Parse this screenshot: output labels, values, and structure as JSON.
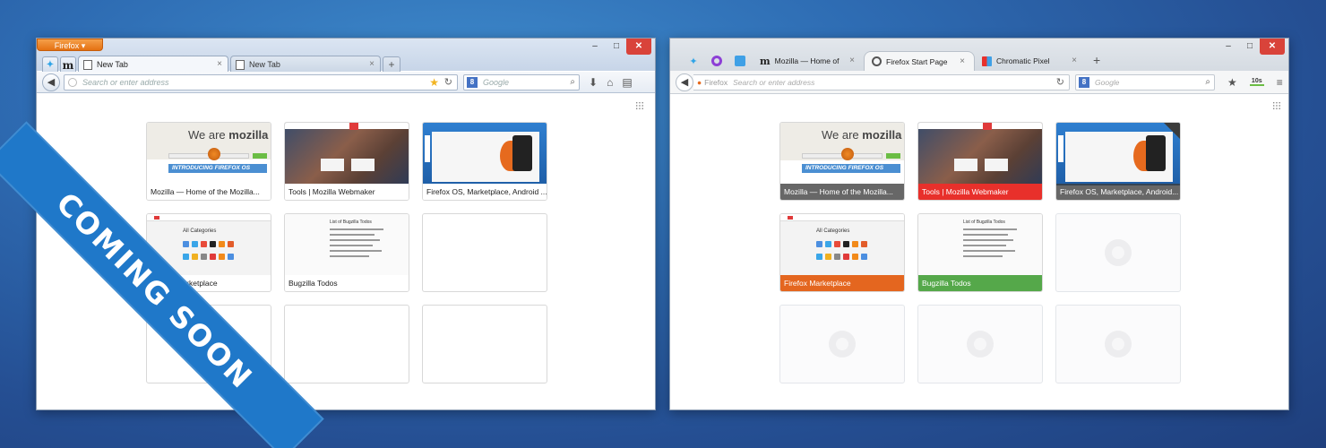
{
  "left_window": {
    "firefox_menu": "Firefox ▾",
    "tabs": [
      {
        "label": "New Tab",
        "close": "×"
      },
      {
        "label": "New Tab",
        "close": "×"
      }
    ],
    "new_tab_plus": "+",
    "url_placeholder": "Search or enter address",
    "search_engine": "Google",
    "tiles": [
      {
        "caption": "Mozilla — Home of the Mozilla...",
        "thumb": "mozilla"
      },
      {
        "caption": "Tools | Mozilla Webmaker",
        "thumb": "webmaker"
      },
      {
        "caption": "Firefox OS, Marketplace, Android ...",
        "thumb": "firefox-os"
      },
      {
        "caption": "Firefox Marketplace",
        "thumb": "marketplace"
      },
      {
        "caption": "Bugzilla Todos",
        "thumb": "bugzilla"
      },
      {
        "caption": "",
        "thumb": "empty"
      },
      {
        "caption": "",
        "thumb": "empty"
      },
      {
        "caption": "",
        "thumb": "empty"
      },
      {
        "caption": "",
        "thumb": "empty"
      }
    ]
  },
  "right_window": {
    "tabs": [
      {
        "label": "Mozilla — Home of",
        "close": "×"
      },
      {
        "label": "Firefox Start Page",
        "close": "×"
      },
      {
        "label": "Chromatic Pixel",
        "close": "×"
      }
    ],
    "new_tab_plus": "+",
    "url_identity": "Firefox",
    "url_placeholder": "Search or enter address",
    "search_engine": "Google",
    "download_label": "10s",
    "tiles": [
      {
        "caption": "Mozilla — Home of the Mozilla...",
        "thumb": "mozilla",
        "style": "dark"
      },
      {
        "caption": "Tools | Mozilla Webmaker",
        "thumb": "webmaker",
        "style": "red"
      },
      {
        "caption": "Firefox OS, Marketplace, Android...",
        "thumb": "firefox-os",
        "style": "dark"
      },
      {
        "caption": "Firefox Marketplace",
        "thumb": "marketplace",
        "style": "orange"
      },
      {
        "caption": "Bugzilla Todos",
        "thumb": "bugzilla",
        "style": "green"
      },
      {
        "caption": "",
        "thumb": "empty"
      },
      {
        "caption": "",
        "thumb": "empty"
      },
      {
        "caption": "",
        "thumb": "empty"
      },
      {
        "caption": "",
        "thumb": "empty"
      }
    ]
  },
  "thumb_text": {
    "mozilla_slogan_pre": "We are ",
    "mozilla_slogan_bold": "mozilla",
    "mozilla_banner": "INTRODUCING FIREFOX OS",
    "marketplace_category": "All Categories",
    "bugzilla_title": "List of Bugzilla Todos"
  },
  "window_controls": {
    "minimize": "–",
    "maximize": "□",
    "close": "✕"
  },
  "ribbon": {
    "text": "COMING SOON",
    "color": "#1f78c9"
  }
}
